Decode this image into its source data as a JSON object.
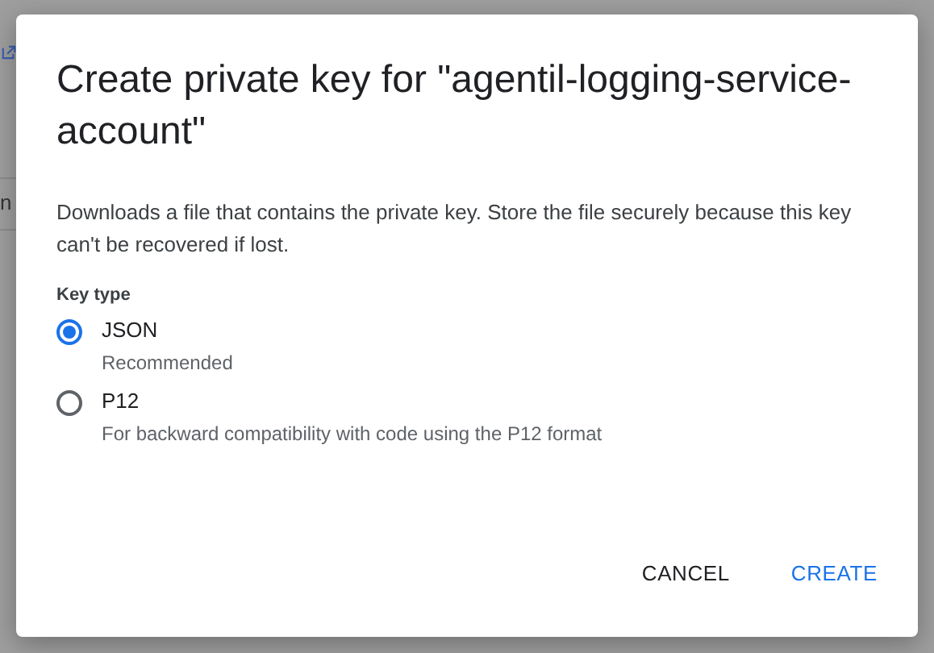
{
  "background": {
    "text": "n"
  },
  "dialog": {
    "title": "Create private key for \"agentil-logging-service-account\"",
    "description": "Downloads a file that contains the private key. Store the file securely because this key can't be recovered if lost.",
    "key_type": {
      "label": "Key type",
      "options": [
        {
          "label": "JSON",
          "hint": "Recommended",
          "selected": true
        },
        {
          "label": "P12",
          "hint": "For backward compatibility with code using the P12 format",
          "selected": false
        }
      ]
    },
    "buttons": [
      {
        "label": "CANCEL",
        "kind": "secondary"
      },
      {
        "label": "CREATE",
        "kind": "primary"
      }
    ]
  }
}
